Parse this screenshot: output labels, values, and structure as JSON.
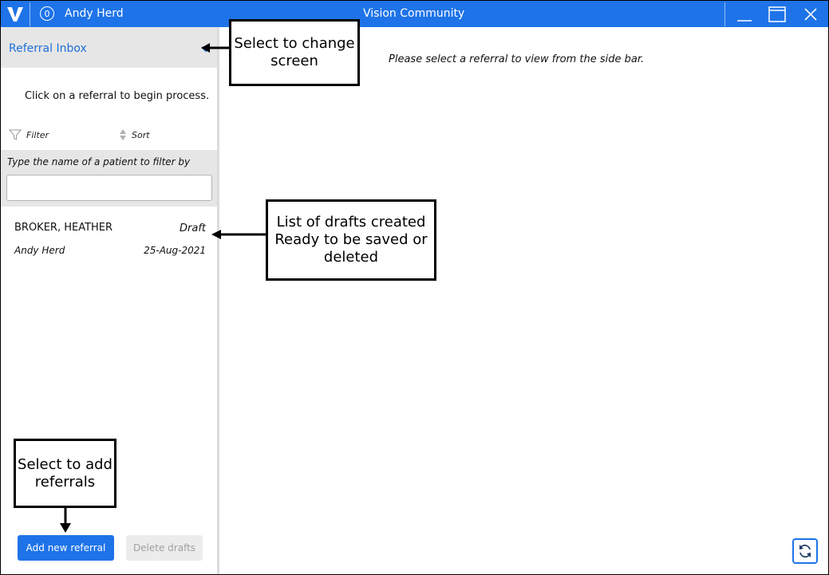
{
  "titlebar": {
    "notification_count": "0",
    "user_name": "Andy Herd",
    "app_title": "Vision Community"
  },
  "sidebar": {
    "screen_title": "Referral Inbox",
    "hint": "Click on a referral to begin process.",
    "filter_label": "Filter",
    "sort_label": "Sort",
    "filter_field_label": "Type the name of a patient to filter by",
    "filter_value": "",
    "referrals": [
      {
        "patient": "BROKER, HEATHER",
        "status": "Draft",
        "author": "Andy Herd",
        "date": "25-Aug-2021"
      }
    ],
    "add_button": "Add new referral",
    "delete_button": "Delete drafts"
  },
  "main": {
    "message": "Please select a referral to view from the side bar."
  },
  "annotations": {
    "change_screen": "Select to change screen",
    "drafts": "List of drafts created Ready to be saved or deleted",
    "add_referrals": "Select to add referrals"
  },
  "colors": {
    "accent": "#1e73e8",
    "panel_grey": "#e6e6e6"
  }
}
